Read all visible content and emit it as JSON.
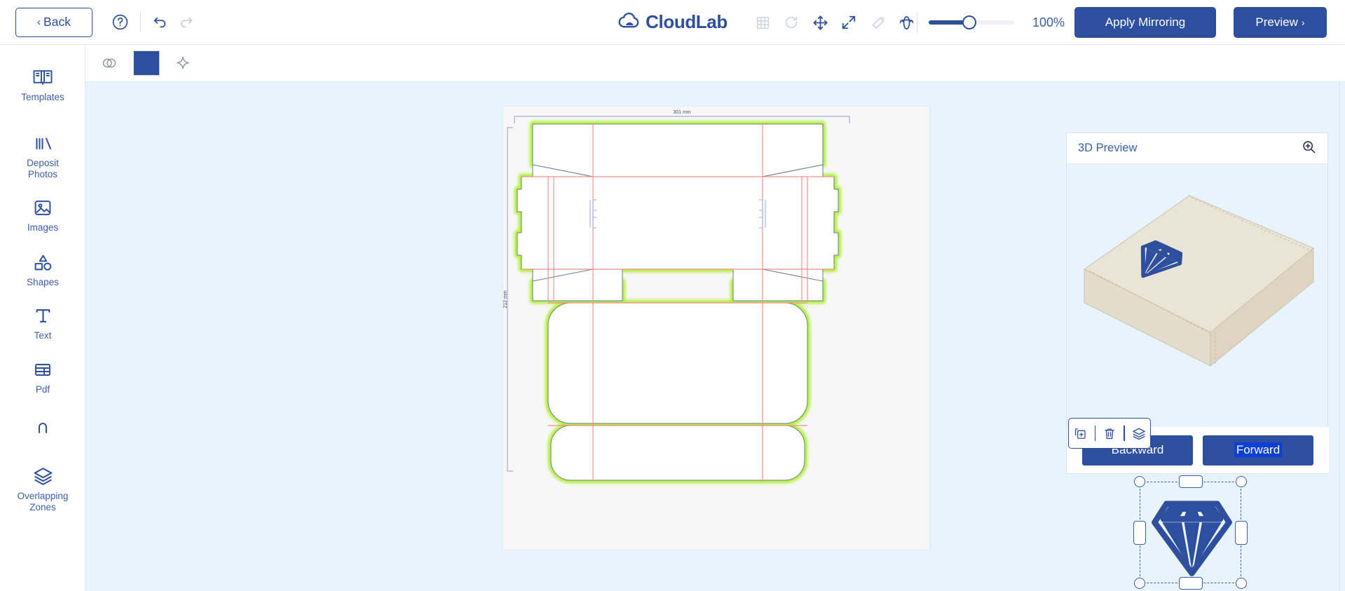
{
  "app": {
    "brand": "CloudLab",
    "brand_color": "#2e4f9e",
    "accent_color": "#2e4f9e",
    "cut_line_color": "#b4f03c",
    "fold_line_color": "#f78c8c"
  },
  "topbar": {
    "back_label": "Back",
    "back_chevron": "‹",
    "help_icon": "help-circle-icon",
    "undo_icon": "undo-icon",
    "redo_icon": "redo-icon",
    "tools": [
      {
        "name": "grid-icon",
        "label": "Grid",
        "active": false
      },
      {
        "name": "reset-icon",
        "label": "Reset",
        "active": false
      },
      {
        "name": "move-icon",
        "label": "Move",
        "active": true
      },
      {
        "name": "fullscreen-icon",
        "label": "Fit screen",
        "active": true
      },
      {
        "name": "magnet-icon",
        "label": "Snap",
        "active": false
      },
      {
        "name": "rotate-3d-icon",
        "label": "Rotate",
        "active": true
      }
    ],
    "zoom_value": "100%",
    "zoom_percent": 100,
    "apply_mirroring_label": "Apply Mirroring",
    "preview_label": "Preview",
    "preview_chevron": "›"
  },
  "sidebar": {
    "items": [
      {
        "key": "templates",
        "label": "Templates",
        "icon": "open-book-icon"
      },
      {
        "key": "deposit",
        "label": "Deposit\nPhotos",
        "icon": "photo-library-icon"
      },
      {
        "key": "images",
        "label": "Images",
        "icon": "image-icon"
      },
      {
        "key": "shapes",
        "label": "Shapes",
        "icon": "shapes-icon"
      },
      {
        "key": "text",
        "label": "Text",
        "icon": "text-t-icon"
      },
      {
        "key": "pdf",
        "label": "Pdf",
        "icon": "table-grid-icon"
      },
      {
        "key": "partial",
        "label": "",
        "icon": "partial-cut-icon"
      },
      {
        "key": "overlap",
        "label": "Overlapping\nZones",
        "icon": "layers-icon"
      }
    ],
    "labels": {
      "templates": "Templates",
      "deposit_line1": "Deposit",
      "deposit_line2": "Photos",
      "images": "Images",
      "shapes": "Shapes",
      "text": "Text",
      "pdf": "Pdf",
      "overlap_line1": "Overlapping",
      "overlap_line2": "Zones"
    }
  },
  "subtoolbar": {
    "items": [
      {
        "name": "opacity-blend-icon",
        "label": "Blend"
      },
      {
        "name": "fill-color-swatch",
        "label": "Fill color",
        "value": "#2e4f9e"
      },
      {
        "name": "effects-sparkle-icon",
        "label": "Effects"
      }
    ]
  },
  "canvas": {
    "dimension_width": "301 mm",
    "dimension_height": "212 mm",
    "object_toolbar": [
      {
        "name": "duplicate-icon",
        "label": "Duplicate"
      },
      {
        "name": "delete-icon",
        "label": "Delete"
      },
      {
        "name": "layers-icon",
        "label": "Layers"
      }
    ],
    "selected_object": "diamond-graphic"
  },
  "preview": {
    "title": "3D Preview",
    "zoom_icon": "zoom-in-icon",
    "backward_label": "Backward",
    "forward_label": "Forward",
    "forward_selected": true,
    "box_color": "#e9e3d4",
    "box_logo": "diamond-graphic"
  }
}
